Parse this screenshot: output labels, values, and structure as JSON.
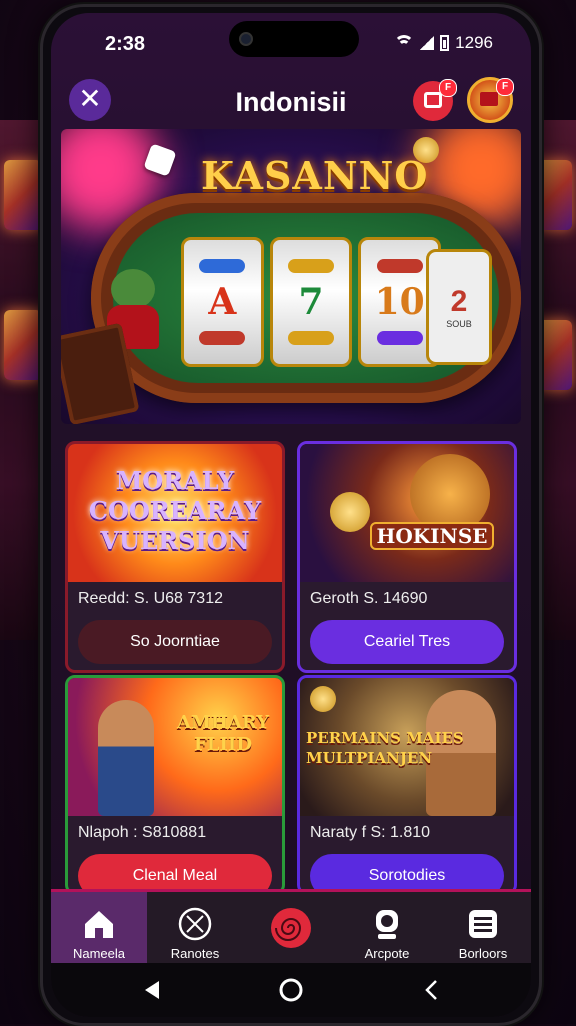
{
  "status_bar": {
    "time": "2:38",
    "right_text": "1296"
  },
  "app_bar": {
    "title": "Indonisii",
    "gift_badge": "F",
    "avatar_badge": "F"
  },
  "hero": {
    "title": "KASANNO",
    "reel_symbols": [
      "A",
      "7",
      "10"
    ],
    "reel4_symbol": "2",
    "reel4_sub": "SOUB"
  },
  "cards": [
    {
      "title": "MORALY COOREARAY VUERSION",
      "meta": "Reedd: S. U68 7312",
      "button": "So Joorntiae",
      "accent": "#8a1a2a"
    },
    {
      "title": "HOKINSE",
      "meta": "Geroth S. 14690",
      "button": "Ceariel Tres",
      "accent": "#6a2ee0"
    },
    {
      "title": "AMHARY FLIID",
      "meta": "Nlapoh : S810881",
      "button": "Clenal Meal",
      "accent": "#e0293b"
    },
    {
      "title": "PERMAINS MAIES MULTPIANJEN",
      "meta": "Naraty f S: 1.810",
      "button": "Sorotodies",
      "accent": "#5a2ae0"
    }
  ],
  "bottom_nav": [
    {
      "label": "Nameela",
      "icon": "home-icon",
      "active": true
    },
    {
      "label": "Ranotes",
      "icon": "compass-icon",
      "active": false
    },
    {
      "label": "",
      "icon": "spiral-icon",
      "active": false
    },
    {
      "label": "Arcpote",
      "icon": "user-icon",
      "active": false
    },
    {
      "label": "Borloors",
      "icon": "menu-icon",
      "active": false
    }
  ]
}
